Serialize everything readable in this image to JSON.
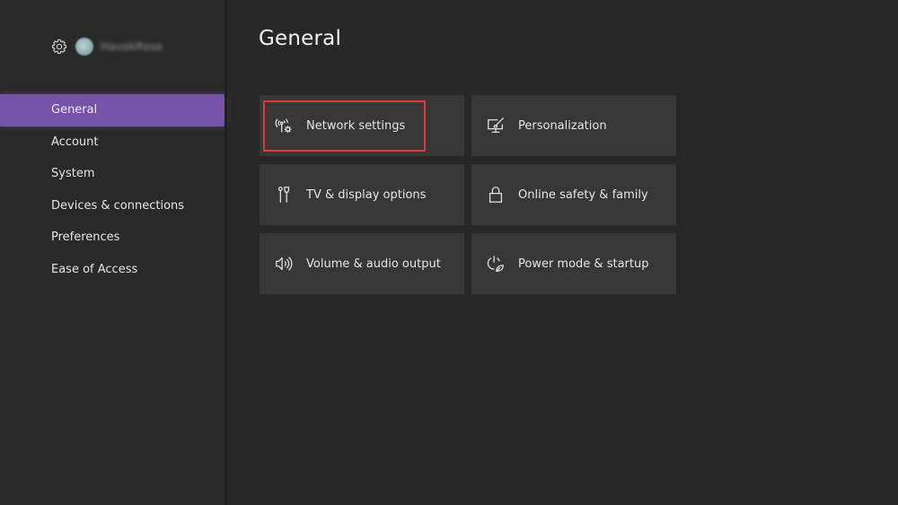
{
  "profile": {
    "settings_icon": "gear-icon",
    "username": "HavokRose"
  },
  "sidebar": {
    "items": [
      {
        "label": "General",
        "active": true
      },
      {
        "label": "Account",
        "active": false
      },
      {
        "label": "System",
        "active": false
      },
      {
        "label": "Devices & connections",
        "active": false
      },
      {
        "label": "Preferences",
        "active": false
      },
      {
        "label": "Ease of Access",
        "active": false
      }
    ]
  },
  "main": {
    "title": "General",
    "tiles": [
      {
        "label": "Network settings",
        "icon": "network-gear-icon",
        "highlighted": true
      },
      {
        "label": "Personalization",
        "icon": "monitor-brush-icon"
      },
      {
        "label": "TV & display options",
        "icon": "hdmi-cable-icon"
      },
      {
        "label": "Online safety & family",
        "icon": "lock-icon"
      },
      {
        "label": "Volume & audio output",
        "icon": "speaker-icon"
      },
      {
        "label": "Power mode & startup",
        "icon": "power-leaf-icon"
      }
    ]
  },
  "colors": {
    "background": "#272727",
    "sidebar_active": "#7453a8",
    "tile": "#373737",
    "highlight": "#e0393a"
  }
}
